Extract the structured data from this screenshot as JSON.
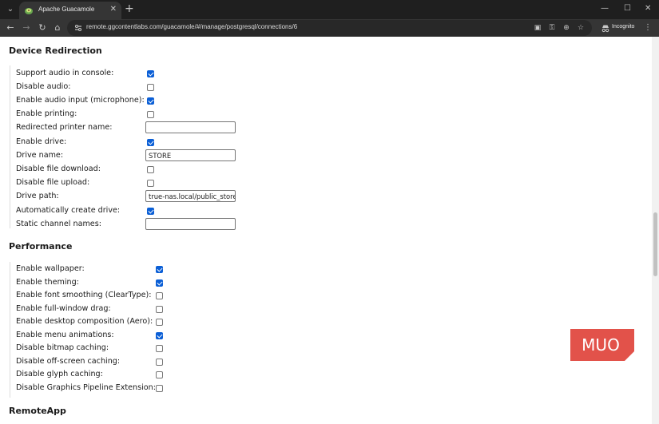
{
  "browser": {
    "tab_title": "Apache Guacamole",
    "url": "remote.ggcontentlabs.com/guacamole/#/manage/postgresql/connections/6",
    "incognito_label": "Incognito",
    "icons": [
      "chevron-down-icon",
      "guacamole-favicon",
      "close-icon",
      "plus-icon",
      "minimize-icon",
      "maximize-icon",
      "window-close-icon",
      "back-icon",
      "forward-icon",
      "reload-icon",
      "home-icon",
      "site-info-icon",
      "save-page-icon",
      "password-icon",
      "zoom-icon",
      "star-icon",
      "incognito-icon",
      "more-icon"
    ]
  },
  "sections": {
    "device_redirection": {
      "title": "Device Redirection",
      "rows": [
        {
          "label": "Support audio in console:",
          "type": "checkbox",
          "checked": true
        },
        {
          "label": "Disable audio:",
          "type": "checkbox",
          "checked": false
        },
        {
          "label": "Enable audio input (microphone):",
          "type": "checkbox",
          "checked": true
        },
        {
          "label": "Enable printing:",
          "type": "checkbox",
          "checked": false
        },
        {
          "label": "Redirected printer name:",
          "type": "text",
          "value": ""
        },
        {
          "label": "Enable drive:",
          "type": "checkbox",
          "checked": true
        },
        {
          "label": "Drive name:",
          "type": "text",
          "value": "STORE"
        },
        {
          "label": "Disable file download:",
          "type": "checkbox",
          "checked": false
        },
        {
          "label": "Disable file upload:",
          "type": "checkbox",
          "checked": false
        },
        {
          "label": "Drive path:",
          "type": "text",
          "value": "true-nas.local/public_store"
        },
        {
          "label": "Automatically create drive:",
          "type": "checkbox",
          "checked": true
        },
        {
          "label": "Static channel names:",
          "type": "text",
          "value": ""
        }
      ]
    },
    "performance": {
      "title": "Performance",
      "rows": [
        {
          "label": "Enable wallpaper:",
          "type": "checkbox",
          "checked": true
        },
        {
          "label": "Enable theming:",
          "type": "checkbox",
          "checked": true
        },
        {
          "label": "Enable font smoothing (ClearType):",
          "type": "checkbox",
          "checked": false
        },
        {
          "label": "Enable full-window drag:",
          "type": "checkbox",
          "checked": false
        },
        {
          "label": "Enable desktop composition (Aero):",
          "type": "checkbox",
          "checked": false
        },
        {
          "label": "Enable menu animations:",
          "type": "checkbox",
          "checked": true
        },
        {
          "label": "Disable bitmap caching:",
          "type": "checkbox",
          "checked": false
        },
        {
          "label": "Disable off-screen caching:",
          "type": "checkbox",
          "checked": false
        },
        {
          "label": "Disable glyph caching:",
          "type": "checkbox",
          "checked": false
        },
        {
          "label": "Disable Graphics Pipeline Extension:",
          "type": "checkbox",
          "checked": false
        }
      ]
    },
    "remoteapp": {
      "title": "RemoteApp"
    }
  },
  "watermark": {
    "text": "MUO",
    "color": "#e2524a"
  },
  "colors": {
    "checkbox_checked": "#0b5fd6",
    "chrome_dark": "#1f1f1f",
    "toolbar": "#353535"
  }
}
